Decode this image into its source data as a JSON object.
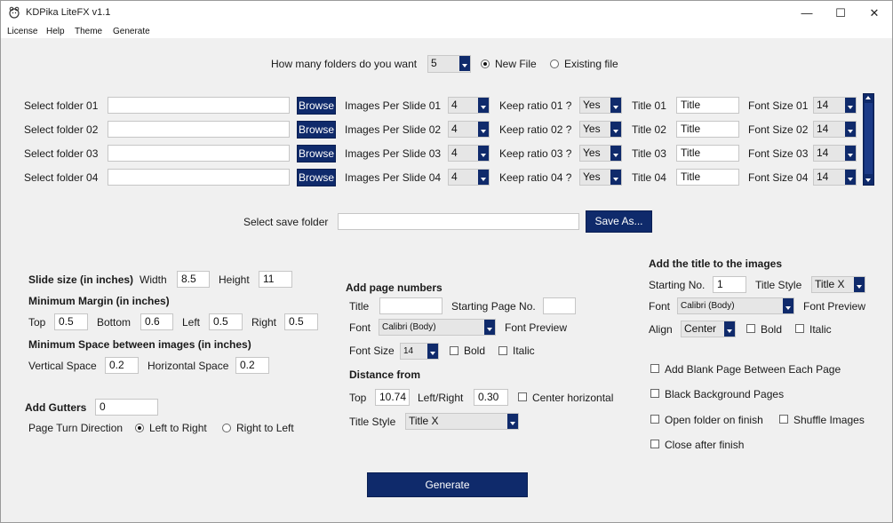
{
  "window": {
    "title": "KDPika LiteFX v1.1",
    "minimize": "—",
    "maximize": "☐",
    "close": "✕"
  },
  "menu": [
    "License",
    "Help",
    "Theme",
    "Generate"
  ],
  "top": {
    "folders_label": "How many folders do you want",
    "folders_value": "5",
    "new_file": "New File",
    "existing_file": "Existing file"
  },
  "folders": [
    {
      "select_label": "Select folder 01",
      "path": "",
      "browse": "Browse",
      "ips_label": "Images Per Slide 01",
      "ips_value": "4",
      "keep_label": "Keep ratio 01 ?",
      "keep_value": "Yes",
      "title_label": "Title 01",
      "title_value": "Title",
      "font_label": "Font Size 01",
      "font_value": "14"
    },
    {
      "select_label": "Select folder 02",
      "path": "",
      "browse": "Browse",
      "ips_label": "Images Per Slide 02",
      "ips_value": "4",
      "keep_label": "Keep ratio 02 ?",
      "keep_value": "Yes",
      "title_label": "Title 02",
      "title_value": "Title",
      "font_label": "Font Size 02",
      "font_value": "14"
    },
    {
      "select_label": "Select folder 03",
      "path": "",
      "browse": "Browse",
      "ips_label": "Images Per Slide 03",
      "ips_value": "4",
      "keep_label": "Keep ratio 03 ?",
      "keep_value": "Yes",
      "title_label": "Title 03",
      "title_value": "Title",
      "font_label": "Font Size 03",
      "font_value": "14"
    },
    {
      "select_label": "Select folder 04",
      "path": "",
      "browse": "Browse",
      "ips_label": "Images Per Slide 04",
      "ips_value": "4",
      "keep_label": "Keep ratio 04 ?",
      "keep_value": "Yes",
      "title_label": "Title 04",
      "title_value": "Title",
      "font_label": "Font Size 04",
      "font_value": "14"
    }
  ],
  "save": {
    "label": "Select save folder",
    "path": "",
    "button": "Save As..."
  },
  "slide": {
    "heading": "Slide size (in inches)",
    "width_label": "Width",
    "width_value": "8.5",
    "height_label": "Height",
    "height_value": "11",
    "margin_heading": "Minimum Margin (in inches)",
    "top_label": "Top",
    "top_value": "0.5",
    "bottom_label": "Bottom",
    "bottom_value": "0.6",
    "left_label": "Left",
    "left_value": "0.5",
    "right_label": "Right",
    "right_value": "0.5",
    "space_heading": "Minimum Space between images (in inches)",
    "vspace_label": "Vertical Space",
    "vspace_value": "0.2",
    "hspace_label": "Horizontal Space",
    "hspace_value": "0.2"
  },
  "gutters": {
    "label": "Add Gutters",
    "value": "0",
    "direction_label": "Page Turn Direction",
    "ltr": "Left to Right",
    "rtl": "Right to Left"
  },
  "page_numbers": {
    "heading": "Add page numbers",
    "title_label": "Title",
    "title_value": "",
    "start_label": "Starting Page No.",
    "start_value": "",
    "font_label": "Font",
    "font_value": "Calibri (Body)",
    "preview": "Font Preview",
    "size_label": "Font Size",
    "size_value": "14",
    "bold": "Bold",
    "italic": "Italic",
    "distance_heading": "Distance from",
    "top_label": "Top",
    "top_value": "10.74",
    "lr_label": "Left/Right",
    "lr_value": "0.30",
    "center": "Center horizontal",
    "style_label": "Title Style",
    "style_value": "Title X"
  },
  "title_images": {
    "heading": "Add the title to the images",
    "start_label": "Starting No.",
    "start_value": "1",
    "style_label": "Title Style",
    "style_value": "Title X",
    "font_label": "Font",
    "font_value": "Calibri (Body)",
    "preview": "Font Preview",
    "align_label": "Align",
    "align_value": "Center",
    "bold": "Bold",
    "italic": "Italic"
  },
  "options": {
    "blank_page": "Add Blank Page Between Each Page",
    "black_bg": "Black Background Pages",
    "open_folder": "Open folder on finish",
    "shuffle": "Shuffle Images",
    "close_after": "Close after finish"
  },
  "generate": "Generate",
  "colors": {
    "accent": "#0f2a6b"
  }
}
